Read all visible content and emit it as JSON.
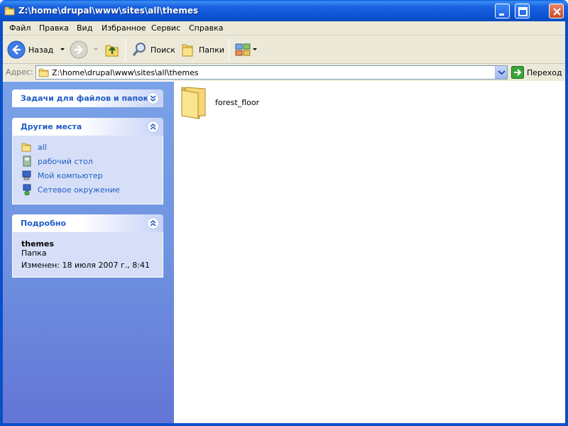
{
  "window": {
    "title": "Z:\\home\\drupal\\www\\sites\\all\\themes"
  },
  "menu": {
    "items": [
      "Файл",
      "Правка",
      "Вид",
      "Избранное",
      "Сервис",
      "Справка"
    ]
  },
  "toolbar": {
    "back_label": "Назад",
    "search_label": "Поиск",
    "folders_label": "Папки"
  },
  "address": {
    "label": "Адрес:",
    "value": "Z:\\home\\drupal\\www\\sites\\all\\themes",
    "go_label": "Переход"
  },
  "left_pane": {
    "tasks": {
      "title": "Задачи для файлов и папок"
    },
    "other_places": {
      "title": "Другие места",
      "items": [
        {
          "label": "all",
          "icon": "folder-icon"
        },
        {
          "label": "рабочий стол",
          "icon": "desktop-icon"
        },
        {
          "label": "Мой компьютер",
          "icon": "my-computer-icon"
        },
        {
          "label": "Сетевое окружение",
          "icon": "network-icon"
        }
      ]
    },
    "details": {
      "title": "Подробно",
      "name": "themes",
      "type": "Папка",
      "modified": "Изменен: 18 июля 2007 г., 8:41"
    }
  },
  "content": {
    "items": [
      {
        "name": "forest_floor",
        "icon": "folder-icon"
      }
    ]
  },
  "colors": {
    "titlebar": "#0a4fc8",
    "link": "#215dc6",
    "chrome": "#ece9d8",
    "pane": "#6f93e0"
  }
}
